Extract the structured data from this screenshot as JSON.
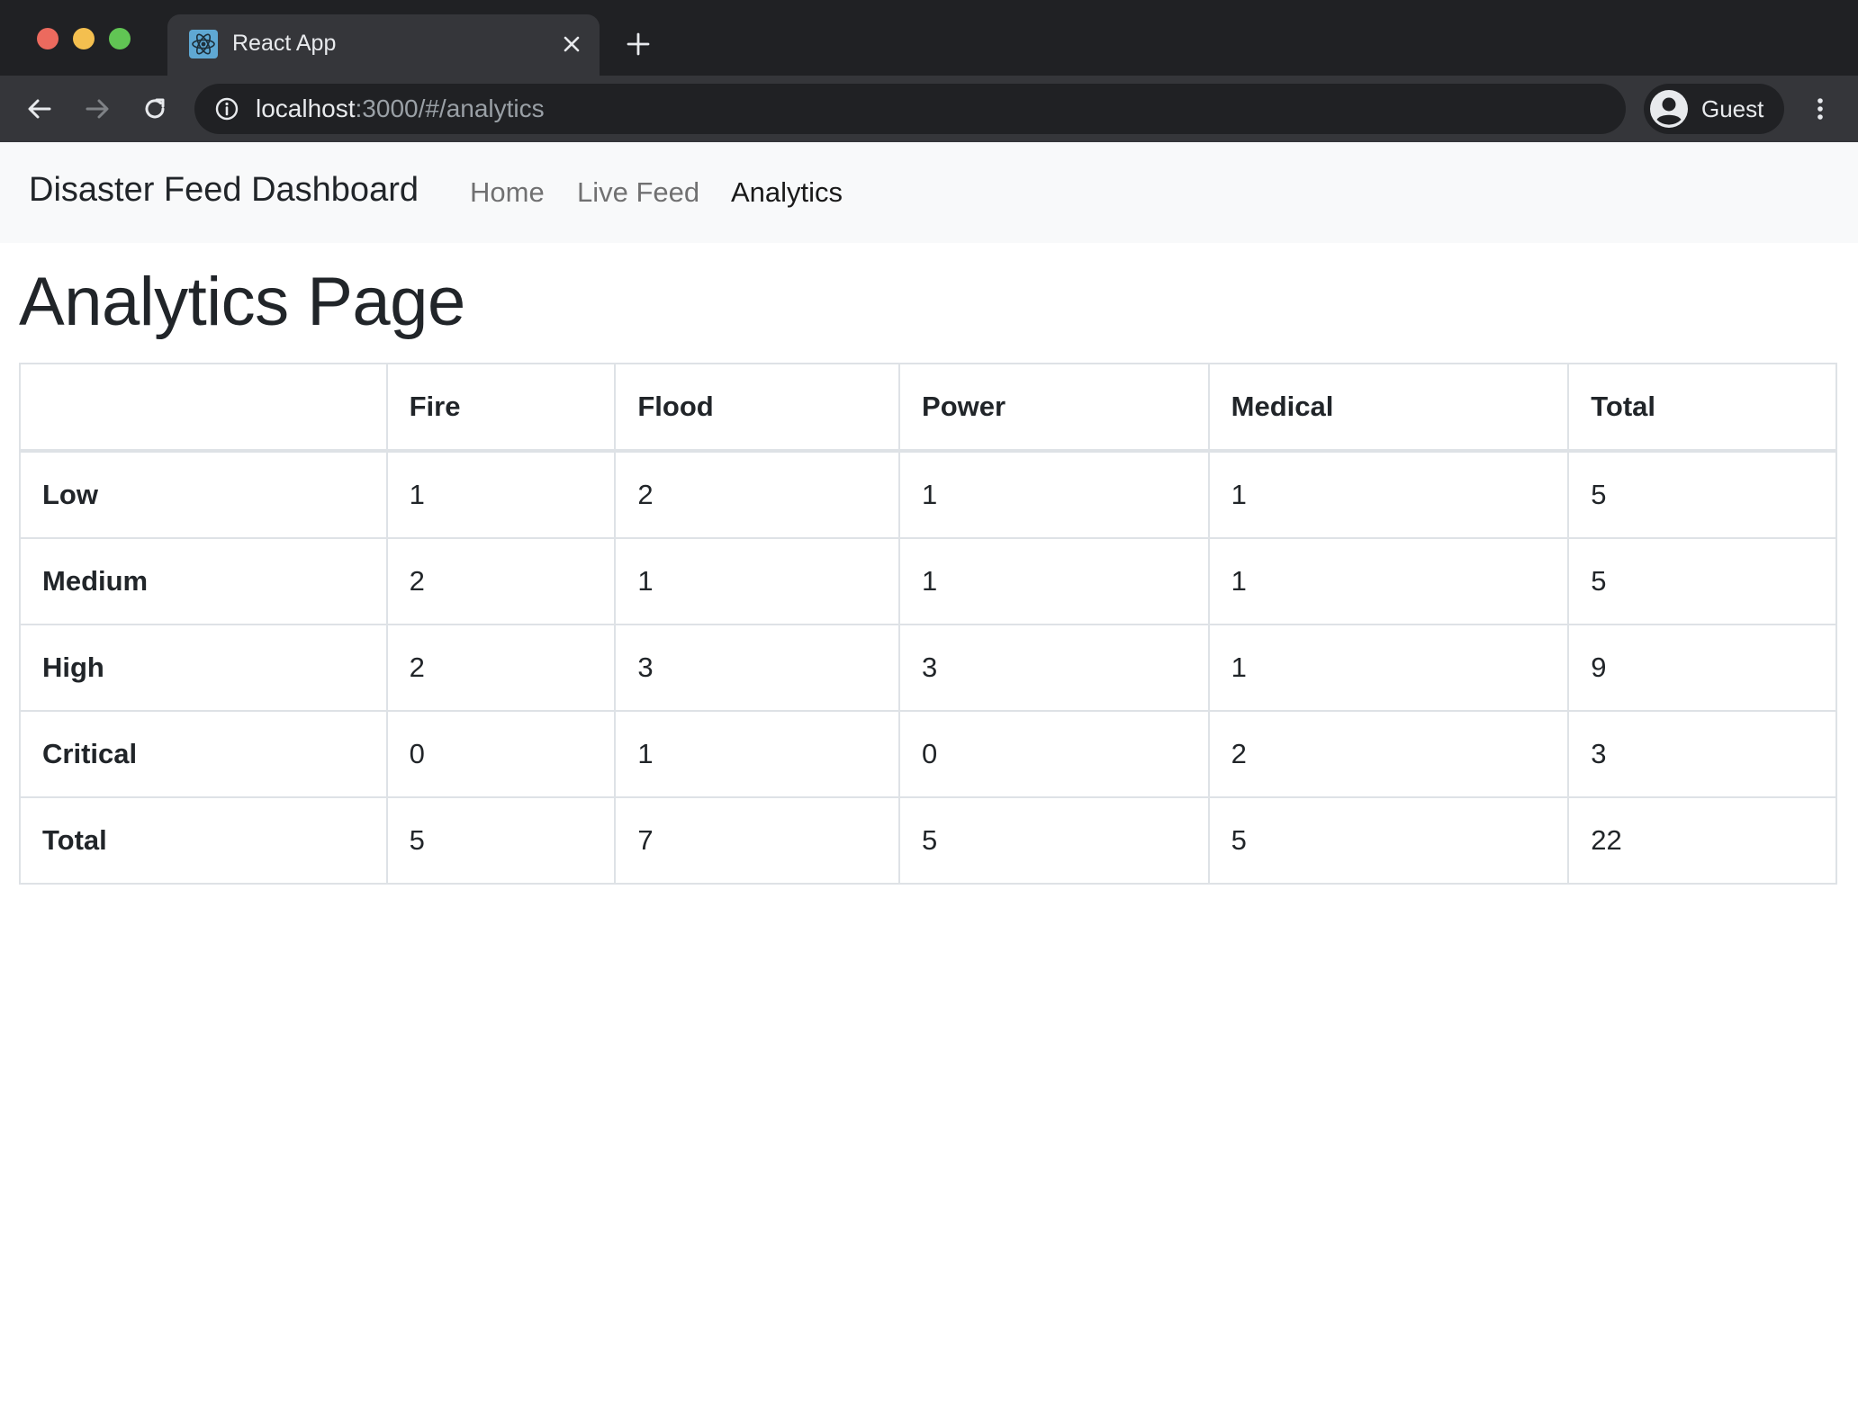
{
  "browser": {
    "tab_title": "React App",
    "url_host": "localhost",
    "url_rest": ":3000/#/analytics",
    "profile_label": "Guest",
    "accent_colors": {
      "close": "#ec6a5e",
      "minimize": "#f4bf4f",
      "maximize": "#61c554",
      "favicon": "#5fa8d3"
    }
  },
  "navbar": {
    "brand": "Disaster Feed Dashboard",
    "links": [
      {
        "label": "Home",
        "active": false
      },
      {
        "label": "Live Feed",
        "active": false
      },
      {
        "label": "Analytics",
        "active": true
      }
    ]
  },
  "page": {
    "title": "Analytics Page"
  },
  "chart_data": {
    "type": "table",
    "columns": [
      "",
      "Fire",
      "Flood",
      "Power",
      "Medical",
      "Total"
    ],
    "rows": [
      {
        "label": "Low",
        "values": [
          "1",
          "2",
          "1",
          "1",
          "5"
        ]
      },
      {
        "label": "Medium",
        "values": [
          "2",
          "1",
          "1",
          "1",
          "5"
        ]
      },
      {
        "label": "High",
        "values": [
          "2",
          "3",
          "3",
          "1",
          "9"
        ]
      },
      {
        "label": "Critical",
        "values": [
          "0",
          "1",
          "0",
          "2",
          "3"
        ]
      },
      {
        "label": "Total",
        "values": [
          "5",
          "7",
          "5",
          "5",
          "22"
        ]
      }
    ]
  }
}
